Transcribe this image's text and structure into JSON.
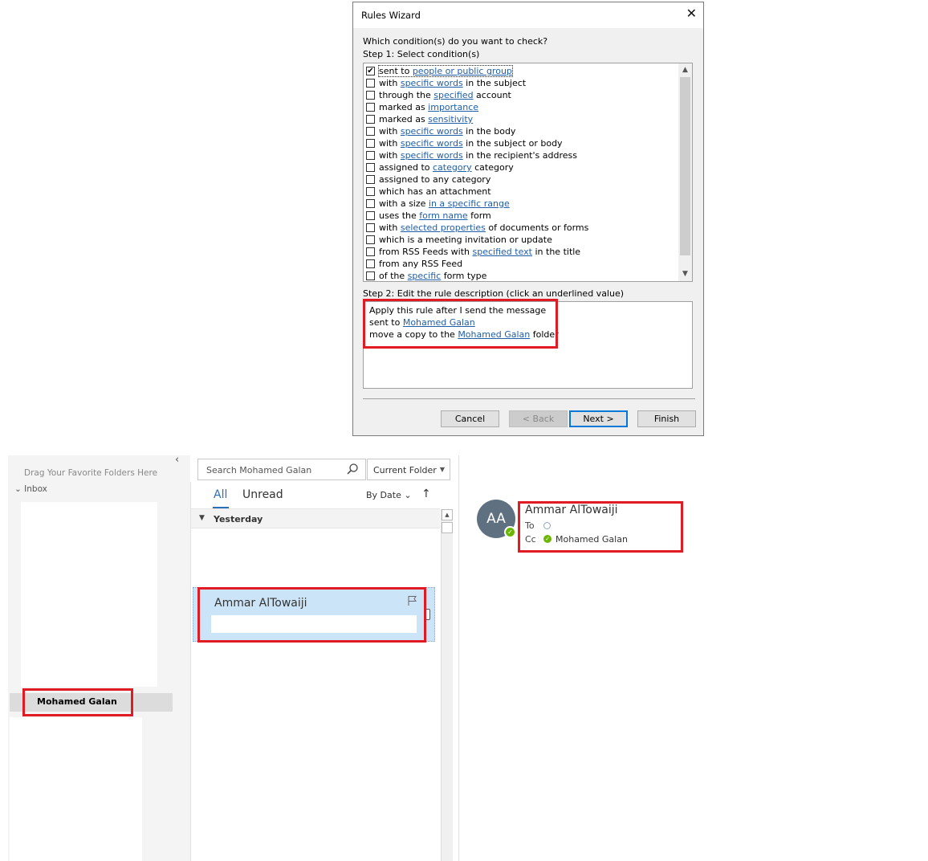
{
  "dialog": {
    "title": "Rules Wizard",
    "close_glyph": "✕",
    "question": "Which condition(s) do you want to check?",
    "step1": "Step 1: Select condition(s)",
    "conditions": [
      {
        "checked": true,
        "parts": [
          {
            "t": "sent to "
          },
          {
            "t": "people or public group",
            "link": true
          }
        ]
      },
      {
        "checked": false,
        "parts": [
          {
            "t": "with "
          },
          {
            "t": "specific words",
            "link": true
          },
          {
            "t": " in the subject"
          }
        ]
      },
      {
        "checked": false,
        "parts": [
          {
            "t": "through the "
          },
          {
            "t": "specified",
            "link": true
          },
          {
            "t": " account"
          }
        ]
      },
      {
        "checked": false,
        "parts": [
          {
            "t": "marked as "
          },
          {
            "t": "importance",
            "link": true
          }
        ]
      },
      {
        "checked": false,
        "parts": [
          {
            "t": "marked as "
          },
          {
            "t": "sensitivity",
            "link": true
          }
        ]
      },
      {
        "checked": false,
        "parts": [
          {
            "t": "with "
          },
          {
            "t": "specific words",
            "link": true
          },
          {
            "t": " in the body"
          }
        ]
      },
      {
        "checked": false,
        "parts": [
          {
            "t": "with "
          },
          {
            "t": "specific words",
            "link": true
          },
          {
            "t": " in the subject or body"
          }
        ]
      },
      {
        "checked": false,
        "parts": [
          {
            "t": "with "
          },
          {
            "t": "specific words",
            "link": true
          },
          {
            "t": " in the recipient's address"
          }
        ]
      },
      {
        "checked": false,
        "parts": [
          {
            "t": "assigned to "
          },
          {
            "t": "category",
            "link": true
          },
          {
            "t": " category"
          }
        ]
      },
      {
        "checked": false,
        "parts": [
          {
            "t": "assigned to any category"
          }
        ]
      },
      {
        "checked": false,
        "parts": [
          {
            "t": "which has an attachment"
          }
        ]
      },
      {
        "checked": false,
        "parts": [
          {
            "t": "with a size "
          },
          {
            "t": "in a specific range",
            "link": true
          }
        ]
      },
      {
        "checked": false,
        "parts": [
          {
            "t": "uses the "
          },
          {
            "t": "form name",
            "link": true
          },
          {
            "t": " form"
          }
        ]
      },
      {
        "checked": false,
        "parts": [
          {
            "t": "with "
          },
          {
            "t": "selected properties",
            "link": true
          },
          {
            "t": " of documents or forms"
          }
        ]
      },
      {
        "checked": false,
        "parts": [
          {
            "t": "which is a meeting invitation or update"
          }
        ]
      },
      {
        "checked": false,
        "parts": [
          {
            "t": "from RSS Feeds with "
          },
          {
            "t": "specified text",
            "link": true
          },
          {
            "t": " in the title"
          }
        ]
      },
      {
        "checked": false,
        "parts": [
          {
            "t": "from any RSS Feed"
          }
        ]
      },
      {
        "checked": false,
        "parts": [
          {
            "t": "of the "
          },
          {
            "t": "specific",
            "link": true
          },
          {
            "t": " form type"
          }
        ]
      }
    ],
    "step2": "Step 2: Edit the rule description (click an underlined value)",
    "description": {
      "line1": "Apply this rule after I send the message",
      "line2_pre": "sent to ",
      "line2_link": "Mohamed Galan",
      "line3_pre": "move a copy to the ",
      "line3_link": "Mohamed Galan",
      "line3_post": " folder"
    },
    "buttons": {
      "cancel": "Cancel",
      "back": "< Back",
      "next": "Next >",
      "finish": "Finish"
    }
  },
  "folders": {
    "favorites_hint": "Drag Your Favorite Folders Here",
    "inbox_label": "Inbox",
    "selected_folder": "Mohamed Galan"
  },
  "search": {
    "placeholder": "Search Mohamed Galan",
    "scope": "Current Folder"
  },
  "list": {
    "tab_all": "All",
    "tab_unread": "Unread",
    "sort_by": "By Date",
    "group": "Yesterday",
    "message_sender": "Ammar AlTowaiji"
  },
  "reading": {
    "initials": "AA",
    "sender": "Ammar AlTowaiji",
    "to_label": "To",
    "cc_label": "Cc",
    "cc_name": "Mohamed Galan"
  },
  "colors": {
    "highlight_frame": "#e01b24",
    "link": "#1f5ea8",
    "accent": "#2b6fb6"
  }
}
